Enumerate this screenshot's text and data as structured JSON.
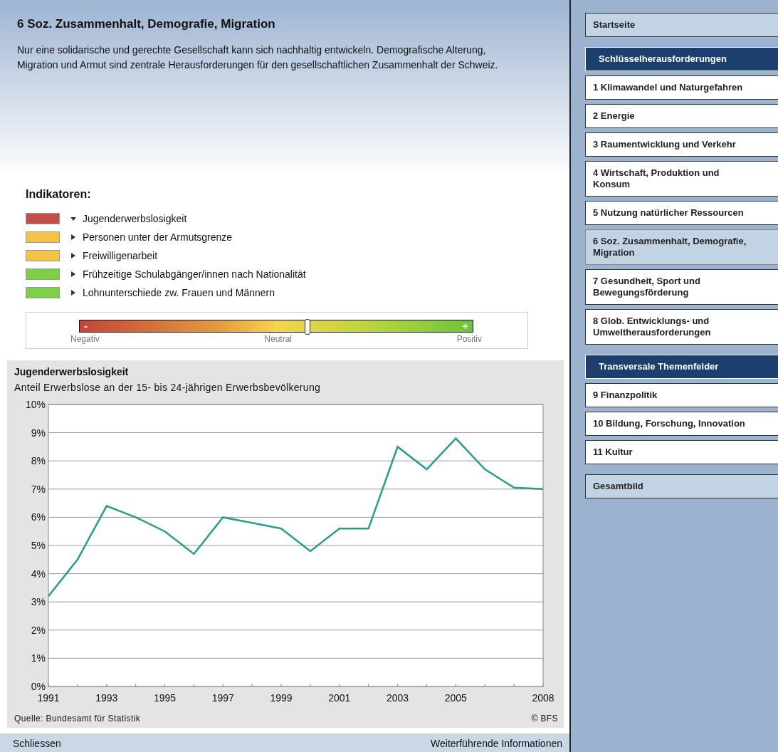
{
  "main": {
    "title": "6 Soz. Zusammenhalt, Demografie, Migration",
    "description": "Nur eine solidarische und gerechte Gesellschaft kann sich nachhaltig entwickeln. Demografische Alterung, Migration und Armut sind zentrale Herausforderungen für den gesellschaftlichen Zusammenhalt der Schweiz."
  },
  "indicators": {
    "heading": "Indikatoren:",
    "items": [
      {
        "label": "Jugenderwerbslosigkeit",
        "color": "#c0504a",
        "expanded": true
      },
      {
        "label": "Personen unter der Armutsgrenze",
        "color": "#f6c244",
        "expanded": false
      },
      {
        "label": "Freiwilligenarbeit",
        "color": "#f6c244",
        "expanded": false
      },
      {
        "label": "Frühzeitige Schulabgänger/innen nach Nationalität",
        "color": "#7ccf46",
        "expanded": false
      },
      {
        "label": "Lohnunterschiede zw. Frauen und Männern",
        "color": "#7ccf46",
        "expanded": false
      }
    ]
  },
  "rating": {
    "minus": "-",
    "plus": "+",
    "level": 0.58,
    "labels": [
      "Negativ",
      "Neutral",
      "Positiv"
    ]
  },
  "chart": {
    "title": "Jugenderwerbslosigkeit",
    "subtitle": "Anteil Erwerbslose an der 15- bis 24-jährigen Erwerbsbevölkerung",
    "chart_data": {
      "type": "line",
      "x": [
        1991,
        1992,
        1993,
        1994,
        1995,
        1996,
        1997,
        1998,
        1999,
        2000,
        2001,
        2002,
        2003,
        2004,
        2005,
        2006,
        2007,
        2008
      ],
      "grid": true,
      "series": [
        {
          "color": "#2a9d8a",
          "values": [
            3.2,
            4.5,
            6.4,
            6.0,
            5.5,
            4.7,
            6.0,
            5.8,
            5.6,
            4.8,
            5.6,
            5.6,
            8.5,
            7.7,
            8.8,
            7.7,
            7.05,
            7.0
          ]
        }
      ],
      "xlim": [
        1991,
        2008
      ],
      "ylim": [
        0,
        10
      ],
      "xticks": [
        1991,
        1993,
        1995,
        1997,
        1999,
        2001,
        2003,
        2005,
        2008
      ],
      "yticks": [
        {
          "value": 0,
          "label": "0%"
        },
        {
          "value": 1,
          "label": "1%"
        },
        {
          "value": 2,
          "label": "2%"
        },
        {
          "value": 3,
          "label": "3%"
        },
        {
          "value": 4,
          "label": "4%"
        },
        {
          "value": 5,
          "label": "5%"
        },
        {
          "value": 6,
          "label": "6%"
        },
        {
          "value": 7,
          "label": "7%"
        },
        {
          "value": 8,
          "label": "8%"
        },
        {
          "value": 9,
          "label": "9%"
        },
        {
          "value": 10,
          "label": "10%"
        }
      ]
    },
    "source": "Quelle: Bundesamt für Statistik",
    "copyright": "© BFS"
  },
  "footer": {
    "close": "Schliessen",
    "more": "Weiterführende Informationen"
  },
  "sidebar": {
    "items": [
      {
        "kind": "link",
        "label": "Startseite",
        "selected": false
      },
      {
        "kind": "header",
        "label": "Schlüsselherausforderungen"
      },
      {
        "kind": "item",
        "label": "1 Klimawandel und Naturgefahren",
        "selected": false
      },
      {
        "kind": "item",
        "label": "2 Energie",
        "selected": false
      },
      {
        "kind": "item",
        "label": "3 Raumentwicklung und Verkehr",
        "selected": false
      },
      {
        "kind": "item",
        "label": "4 Wirtschaft, Produktion und Konsum",
        "selected": false
      },
      {
        "kind": "item",
        "label": "5 Nutzung natürlicher Ressourcen",
        "selected": false
      },
      {
        "kind": "item",
        "label": "6 Soz. Zusammenhalt, Demografie, Migration",
        "selected": true
      },
      {
        "kind": "item",
        "label": "7 Gesundheit, Sport und Bewegungsförderung",
        "selected": false
      },
      {
        "kind": "item",
        "label": "8 Glob. Entwicklungs- und Umweltherausforderungen",
        "selected": false
      },
      {
        "kind": "header",
        "label": "Transversale Themenfelder"
      },
      {
        "kind": "item",
        "label": "9 Finanzpolitik",
        "selected": false
      },
      {
        "kind": "item",
        "label": "10 Bildung, Forschung, Innovation",
        "selected": false
      },
      {
        "kind": "item",
        "label": "11 Kultur",
        "selected": false
      },
      {
        "kind": "link",
        "label": "Gesamtbild",
        "selected": false
      }
    ]
  }
}
